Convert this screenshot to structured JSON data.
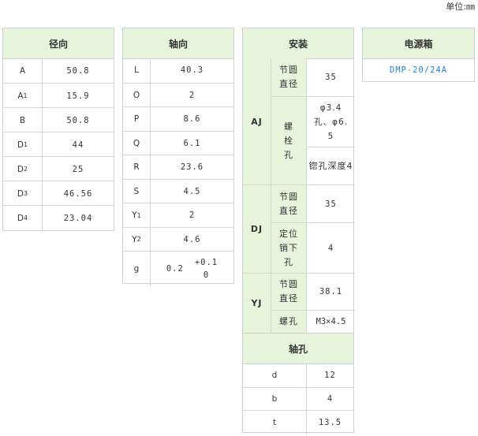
{
  "unit_label": "单位:㎜",
  "radial": {
    "title": "径向",
    "rows": [
      {
        "name": "A",
        "sub": "",
        "value": "50.8"
      },
      {
        "name": "A",
        "sub": "1",
        "value": "15.9"
      },
      {
        "name": "B",
        "sub": "",
        "value": "50.8"
      },
      {
        "name": "D",
        "sub": "1",
        "value": "44"
      },
      {
        "name": "D",
        "sub": "2",
        "value": "25"
      },
      {
        "name": "D",
        "sub": "3",
        "value": "46.56"
      },
      {
        "name": "D",
        "sub": "4",
        "value": "23.04"
      }
    ]
  },
  "axial": {
    "title": "轴向",
    "rows": [
      {
        "name": "L",
        "sub": "",
        "value": "40.3"
      },
      {
        "name": "O",
        "sub": "",
        "value": "2"
      },
      {
        "name": "P",
        "sub": "",
        "value": "8.6"
      },
      {
        "name": "Q",
        "sub": "",
        "value": "6.1"
      },
      {
        "name": "R",
        "sub": "",
        "value": "23.6"
      },
      {
        "name": "S",
        "sub": "",
        "value": "4.5"
      },
      {
        "name": "Y",
        "sub": "1",
        "value": "2"
      },
      {
        "name": "Y",
        "sub": "2",
        "value": "4.6"
      }
    ],
    "g_row": {
      "name": "g",
      "base": "0.2",
      "tol_top": "+0.1",
      "tol_bottom": "0"
    }
  },
  "mount": {
    "title": "安装",
    "aj": {
      "label": "AJ",
      "pcd_label": "节圆直径",
      "pcd_value": "35",
      "bolt_label": "螺栓孔",
      "bolt_value": "φ3.4孔、φ6.5",
      "counterbore": "锪孔深度4"
    },
    "dj": {
      "label": "DJ",
      "pcd_label": "节圆直径",
      "pcd_value": "35",
      "pin_label": "定位销下孔",
      "pin_value": "4"
    },
    "yj": {
      "label": "YJ",
      "pcd_label": "节圆直径",
      "pcd_value": "38.1",
      "screw_label": "螺孔",
      "screw_value": "M3×4.5"
    }
  },
  "shaft_hole": {
    "title": "轴孔",
    "rows": [
      {
        "name": "d",
        "value": "12"
      },
      {
        "name": "b",
        "value": "4"
      },
      {
        "name": "t",
        "value": "13.5"
      }
    ]
  },
  "power": {
    "title": "电源箱",
    "model": "DMP-20/24A"
  }
}
